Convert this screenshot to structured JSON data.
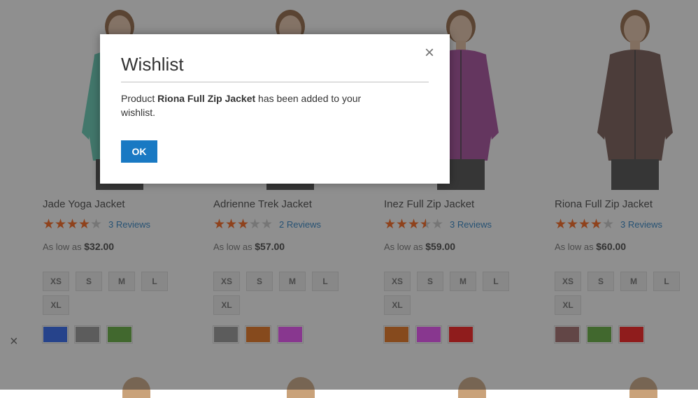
{
  "products": [
    {
      "name": "Jade Yoga Jacket",
      "rating": 0.8,
      "reviews": "3 Reviews",
      "price_prefix": "As low as",
      "price": "$32.00",
      "sizes": [
        "XS",
        "S",
        "M",
        "L",
        "XL"
      ],
      "colors": [
        "#1857f7",
        "#8f8f8f",
        "#53a828"
      ],
      "jacket_color": "#56c9b0"
    },
    {
      "name": "Adrienne Trek Jacket",
      "rating": 0.6,
      "reviews": "2 Reviews",
      "price_prefix": "As low as",
      "price": "$57.00",
      "sizes": [
        "XS",
        "S",
        "M",
        "L",
        "XL"
      ],
      "colors": [
        "#8f8f8f",
        "#eb6703",
        "#ef3dff"
      ],
      "jacket_color": "#3fa9a3"
    },
    {
      "name": "Inez Full Zip Jacket",
      "rating": 0.7,
      "reviews": "3 Reviews",
      "price_prefix": "As low as",
      "price": "$59.00",
      "sizes": [
        "XS",
        "S",
        "M",
        "L",
        "XL"
      ],
      "colors": [
        "#eb6703",
        "#ef3dff",
        "#ff0000"
      ],
      "jacket_color": "#a03a95"
    },
    {
      "name": "Riona Full Zip Jacket",
      "rating": 0.8,
      "reviews": "3 Reviews",
      "price_prefix": "As low as",
      "price": "$60.00",
      "sizes": [
        "XS",
        "S",
        "M",
        "L",
        "XL"
      ],
      "colors": [
        "#9c5d5d",
        "#53a828",
        "#ff0000"
      ],
      "jacket_color": "#6b4a43"
    }
  ],
  "modal": {
    "title": "Wishlist",
    "body_prefix": "Product ",
    "product_name": "Riona Full Zip Jacket",
    "body_suffix": " has been added to your wishlist.",
    "ok_label": "OK",
    "close_glyph": "×"
  },
  "side_close_glyph": "×",
  "colors": {
    "accent": "#1979c3",
    "star": "#ff5501",
    "overlay": "rgba(51,51,51,0.55)"
  }
}
